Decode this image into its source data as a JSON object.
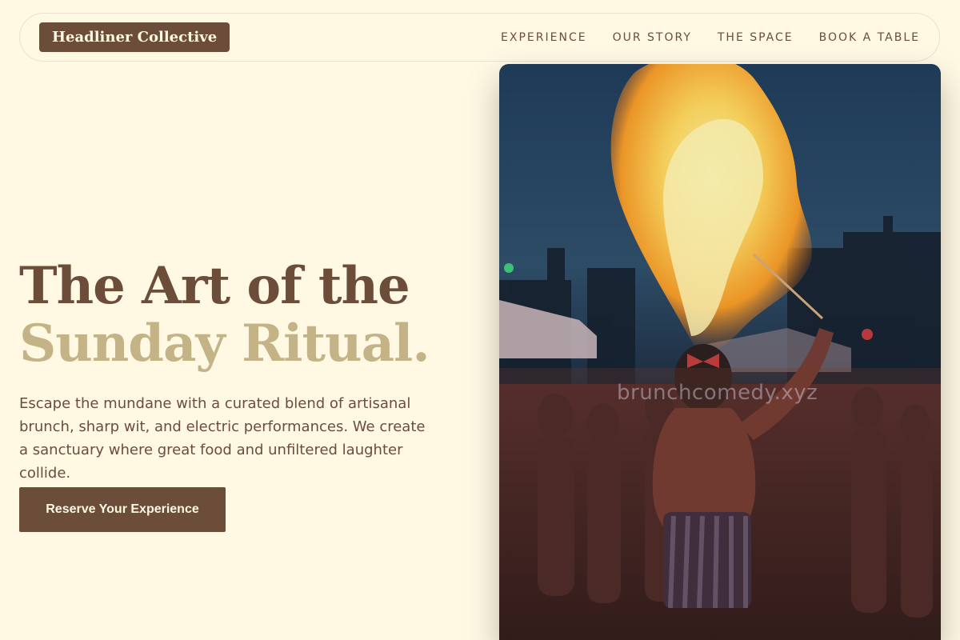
{
  "nav": {
    "brand": "Headliner Collective",
    "links": [
      {
        "label": "EXPERIENCE"
      },
      {
        "label": "OUR STORY"
      },
      {
        "label": "THE SPACE"
      },
      {
        "label": "BOOK A TABLE"
      }
    ]
  },
  "hero": {
    "title_line1": "The Art of the",
    "title_line2": "Sunday Ritual.",
    "description": "Escape the mundane with a curated blend of artisanal brunch, sharp wit, and electric performances. We create a sanctuary where great food and unfiltered laughter collide.",
    "cta_label": "Reserve Your Experience",
    "image_watermark": "brunchcomedy.xyz"
  },
  "colors": {
    "background": "#FFF8E3",
    "brand_brown": "#6C4D39",
    "accent_tan": "#C3B386",
    "nav_border": "#E9E2CF"
  },
  "icons": {
    "hero_image": "fire-performer-photo"
  }
}
